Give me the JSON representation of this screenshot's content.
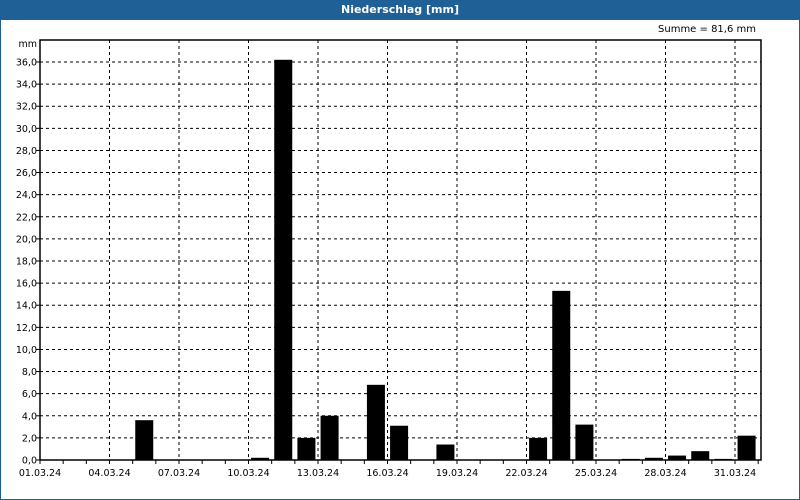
{
  "window": {
    "title": "Niederschlag [mm]"
  },
  "summary": "Summe = 81,6 mm",
  "chart_data": {
    "type": "bar",
    "title": "Niederschlag [mm]",
    "ylabel": "mm",
    "xlabel": "",
    "ylim": [
      0,
      37.5
    ],
    "yticks": [
      "0,0",
      "2,0",
      "4,0",
      "6,0",
      "8,0",
      "10,0",
      "12,0",
      "14,0",
      "16,0",
      "18,0",
      "20,0",
      "22,0",
      "24,0",
      "26,0",
      "28,0",
      "30,0",
      "32,0",
      "34,0",
      "36,0"
    ],
    "xticks": [
      "01.03.24",
      "04.03.24",
      "07.03.24",
      "10.03.24",
      "13.03.24",
      "16.03.24",
      "19.03.24",
      "22.03.24",
      "25.03.24",
      "28.03.24",
      "31.03.24"
    ],
    "grid": true,
    "bar_color": "#000000",
    "days": [
      1,
      2,
      3,
      4,
      5,
      6,
      7,
      8,
      9,
      10,
      11,
      12,
      13,
      14,
      15,
      16,
      17,
      18,
      19,
      20,
      21,
      22,
      23,
      24,
      25,
      26,
      27,
      28,
      29,
      30,
      31
    ],
    "values": [
      0,
      0,
      0,
      0,
      3.6,
      0,
      0,
      0,
      0,
      0.2,
      36.2,
      2.0,
      4.0,
      0,
      6.8,
      3.1,
      0,
      1.4,
      0,
      0,
      0,
      2.0,
      15.3,
      3.2,
      0,
      0.1,
      0.2,
      0.4,
      0.8,
      0.1,
      2.2
    ]
  }
}
